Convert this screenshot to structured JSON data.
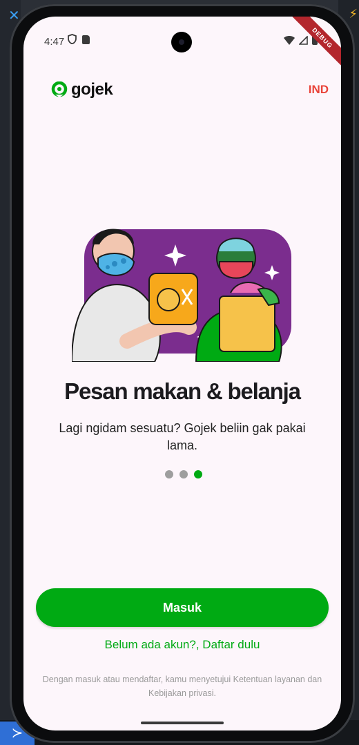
{
  "status_bar": {
    "time": "4:47",
    "debug_label": "DEBUG"
  },
  "header": {
    "logo_text": "gojek",
    "language_label": "IND"
  },
  "onboarding": {
    "title": "Pesan makan & belanja",
    "description": "Lagi ngidam sesuatu? Gojek beliin gak pakai lama.",
    "page_count": 3,
    "active_page": 3
  },
  "actions": {
    "login_label": "Masuk",
    "register_label": "Belum ada akun?, Daftar dulu"
  },
  "legal_text": "Dengan masuk atau mendaftar, kamu menyetujui Ketentuan layanan dan Kebijakan privasi.",
  "colors": {
    "brand_green": "#00aa13",
    "language_red": "#e9443a",
    "illustration_purple": "#7b2d8e",
    "screen_background": "#fdf6fb"
  },
  "icons": [
    "shield-icon",
    "sd-card-icon",
    "wifi-icon",
    "signal-icon",
    "battery-icon",
    "gojek-logo-icon"
  ]
}
